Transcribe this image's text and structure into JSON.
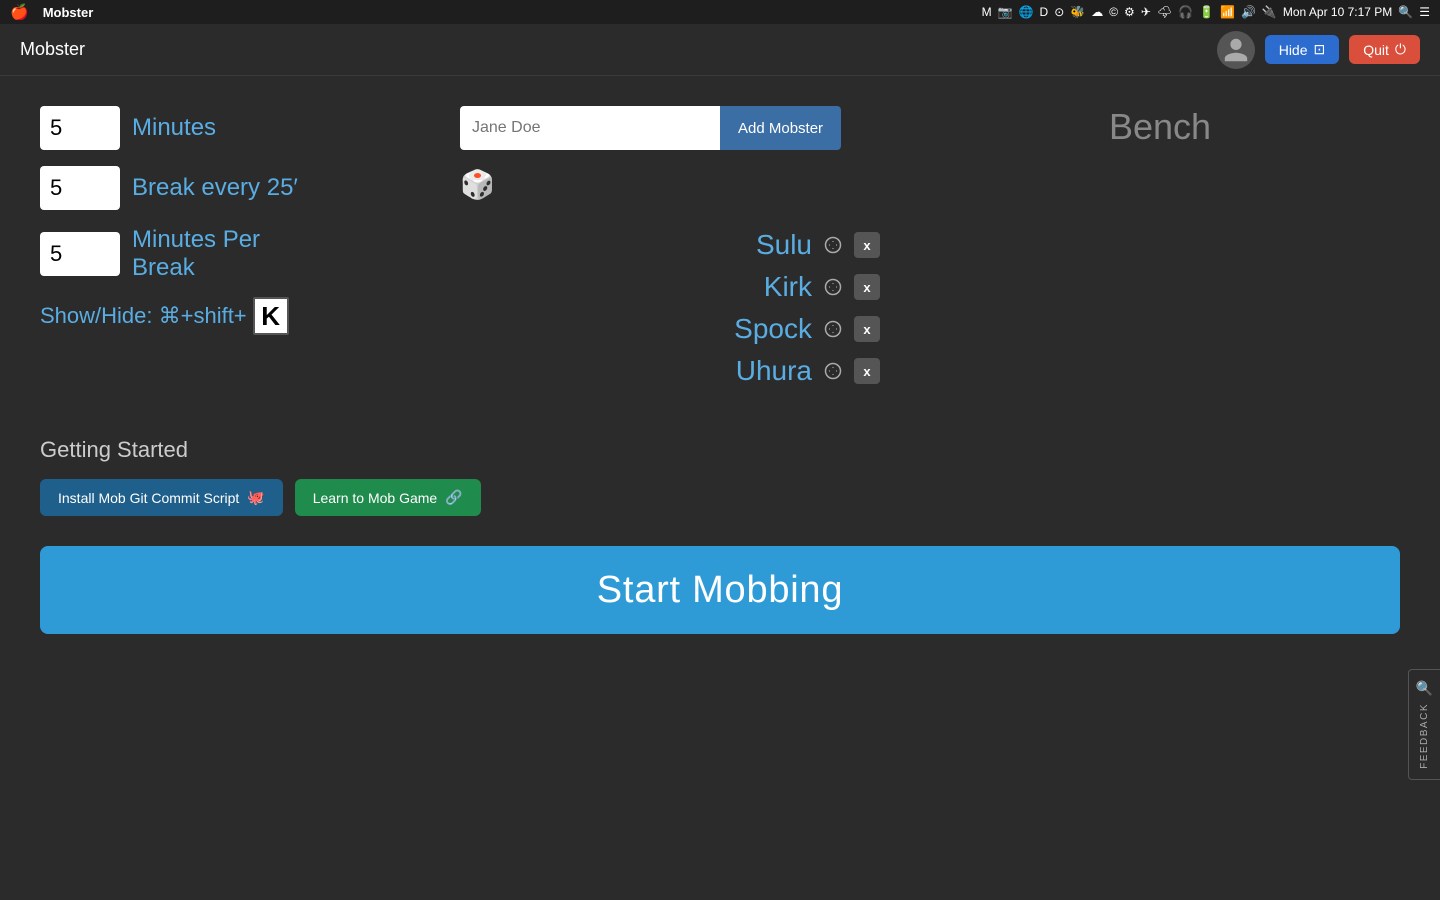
{
  "menubar": {
    "apple": "🍎",
    "app_name": "Mobster",
    "time": "Mon Apr 10  7:17 PM",
    "icons": [
      "M",
      "📷",
      "🌐",
      "D",
      "🔒",
      "🐝",
      "☁",
      "©",
      "⚙",
      "✈",
      "🌩",
      "🎧",
      "🔋",
      "🔌"
    ]
  },
  "titlebar": {
    "title": "Mobster",
    "hide_label": "Hide",
    "quit_label": "Quit"
  },
  "settings": {
    "minutes_value": "5",
    "minutes_label": "Minutes",
    "break_every_value": "5",
    "break_every_label": "Break every 25′",
    "minutes_per_break_value": "5",
    "minutes_per_break_label": "Minutes Per Break",
    "shortcut_label": "Show/Hide: ⌘+shift+",
    "shortcut_key": "K"
  },
  "mobster_input": {
    "placeholder": "Jane Doe",
    "add_button_label": "Add Mobster"
  },
  "mobsters": [
    {
      "name": "Sulu",
      "active": true
    },
    {
      "name": "Kirk",
      "active": false
    },
    {
      "name": "Spock",
      "active": false
    },
    {
      "name": "Uhura",
      "active": false
    }
  ],
  "bench": {
    "title": "Bench"
  },
  "getting_started": {
    "title": "Getting Started",
    "install_button": "Install Mob Git Commit Script",
    "learn_button": "Learn to Mob Game"
  },
  "start_mobbing": {
    "label": "Start Mobbing"
  },
  "feedback": {
    "label": "FEEDBACK"
  }
}
